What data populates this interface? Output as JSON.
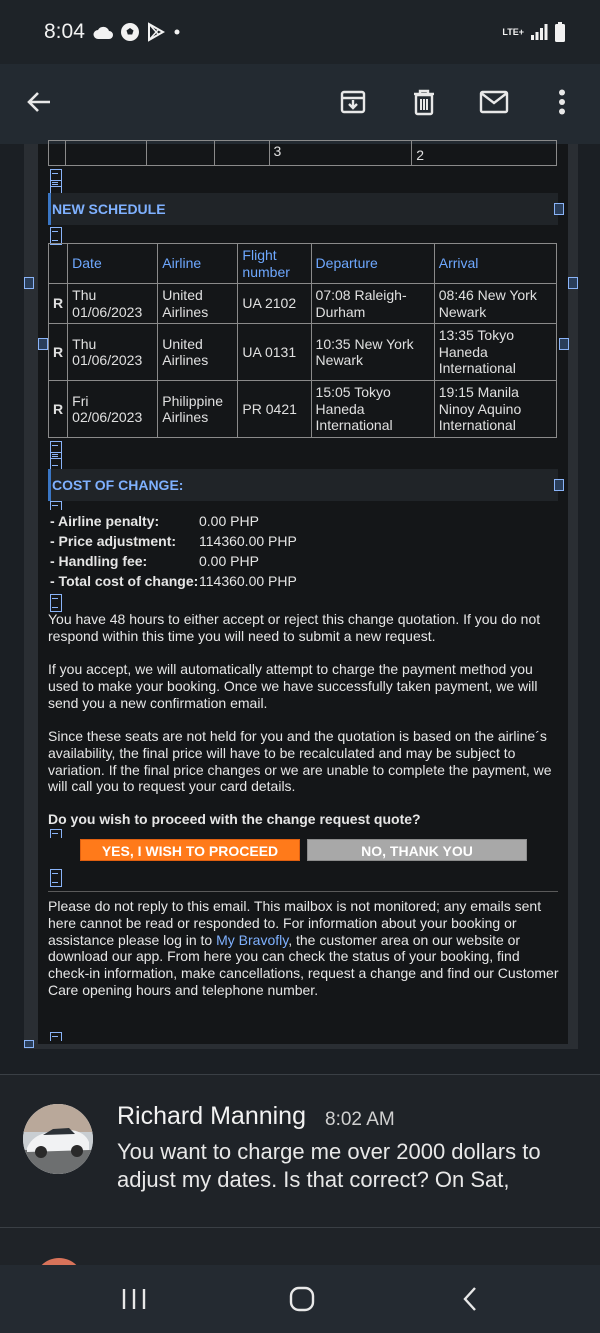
{
  "status_bar": {
    "time": "8:04",
    "icons": [
      "cloud-icon",
      "soccer-ball-icon",
      "play-store-icon",
      "dot-icon"
    ],
    "network": "LTE+",
    "right_icons": [
      "signal-icon",
      "battery-icon"
    ]
  },
  "toolbar": {
    "back": "back-arrow-icon",
    "actions": [
      "archive-icon",
      "delete-icon",
      "mail-icon",
      "more-vert-icon"
    ]
  },
  "top_table_fragment": {
    "cells": [
      "3",
      "2"
    ]
  },
  "new_schedule": {
    "title": "NEW SCHEDULE",
    "headers": [
      "Date",
      "Airline",
      "Flight number",
      "Departure",
      "Arrival"
    ],
    "rows": [
      {
        "mark": "R",
        "date": "Thu 01/06/2023",
        "airline": "United Airlines",
        "flight": "UA 2102",
        "departure": "07:08 Raleigh-Durham",
        "arrival": "08:46 New York Newark"
      },
      {
        "mark": "R",
        "date": "Thu 01/06/2023",
        "airline": "United Airlines",
        "flight": "UA 0131",
        "departure": "10:35 New York Newark",
        "arrival": "13:35 Tokyo Haneda International"
      },
      {
        "mark": "R",
        "date": "Fri 02/06/2023",
        "airline": "Philippine Airlines",
        "flight": "PR 0421",
        "departure": "15:05 Tokyo Haneda International",
        "arrival": "19:15 Manila Ninoy Aquino International"
      }
    ]
  },
  "cost_of_change": {
    "title": "COST OF CHANGE:",
    "items": [
      {
        "label": "- Airline penalty:",
        "value": "0.00 PHP"
      },
      {
        "label": "- Price adjustment:",
        "value": "114360.00 PHP"
      },
      {
        "label": "- Handling fee:",
        "value": "0.00 PHP"
      },
      {
        "label": "- Total cost of change:",
        "value": "114360.00 PHP"
      }
    ]
  },
  "paragraphs": {
    "p1": "You have 48 hours to either accept or reject this change quotation. If you do not respond within this time you will need to submit a new request.",
    "p2": "If you accept, we will automatically attempt to charge the payment method you used to make your booking. Once we have successfully taken payment, we will send you a new confirmation email.",
    "p3": "Since these seats are not held for you and the quotation is based on the airline´s availability, the final price will have to be recalculated and may be subject to variation. If the final price changes or we are unable to complete the payment, we will call you to request your card details.",
    "question": "Do you wish to proceed with the change request quote?"
  },
  "buttons": {
    "yes": "YES, I WISH TO PROCEED",
    "no": "NO, THANK YOU"
  },
  "footer": {
    "text_before": "Please do not reply to this email. This mailbox is not monitored; any emails sent here cannot be read or responded to. For information about your booking or assistance please log in to ",
    "link": "My Bravofly",
    "text_after": ", the customer area on our website or download our app. From here you can check the status of your booking, find check-in information, make cancellations, request a change and find our Customer Care opening hours and telephone number."
  },
  "next_message": {
    "sender": "Richard Manning",
    "time": "8:02 AM",
    "snippet": "You want to charge me over 2000 dollars to adjust my dates. Is that correct? On Sat,"
  },
  "navbar": {
    "buttons": [
      "recent-apps-icon",
      "home-icon",
      "back-icon"
    ]
  },
  "colors": {
    "accent_orange": "#ff7a1a",
    "link_blue": "#7fb1ff",
    "button_gray": "#a8a8a8"
  }
}
